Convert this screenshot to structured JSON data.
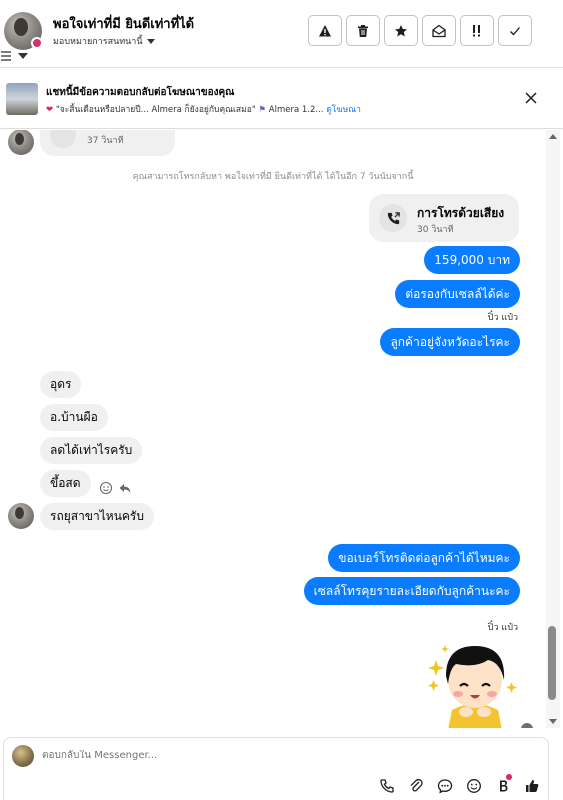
{
  "header": {
    "contact_name": "พอใจเท่าที่มี ยินดีเท่าที่ได้",
    "assign_label": "มอบหมายการสนทนานี้",
    "actions": [
      {
        "name": "report-button",
        "icon": "warning-icon"
      },
      {
        "name": "delete-button",
        "icon": "trash-icon"
      },
      {
        "name": "star-button",
        "icon": "star-icon"
      },
      {
        "name": "mark-unread-button",
        "icon": "envelope-open-icon"
      },
      {
        "name": "flag-button",
        "icon": "exclamation-icon"
      },
      {
        "name": "done-button",
        "icon": "check-icon"
      }
    ]
  },
  "ad_banner": {
    "title": "แชทนี้มีข้อความตอบกลับต่อโฆษณาของคุณ",
    "preview_text": "\"จะสิ้นเดือนหรือปลายปี... Almera ก็ยังอยู่กับคุณเสมอ\"",
    "preview_tail": "Almera 1.2...",
    "link_label": "ดูโฆษณา"
  },
  "thread": {
    "top_call_duration": "37 วินาที",
    "notice": "คุณสามารถโทรกลับหา พอใจเท่าที่มี ยินดีเท่าที่ได้ ได้ในอีก 7 วันนับจากนี้",
    "call_card": {
      "title": "การโทรด้วยเสียง",
      "duration": "30 วินาที"
    },
    "outgoing_1": [
      "159,000 บาท",
      "ต่อรองกับเซลล์ได้ค่ะ"
    ],
    "sender_1": "ปิ๋ว แป๋ว",
    "outgoing_2": [
      "ลูกค้าอยู่จังหวัดอะไรคะ"
    ],
    "incoming": [
      "อุดร",
      "อ.บ้านผือ",
      "ลดได้เท่าไรครับ",
      "ขึ้อสด",
      "รถยุสาขาไหนครับ"
    ],
    "outgoing_3": [
      "ขอเบอร์โทรติดต่อลูกค้าได้ไหมคะ",
      "เซลล์โทรคุยรายละเอียดกับลูกค้านะคะ"
    ],
    "sender_2": "ปิ๋ว แป๋ว"
  },
  "composer": {
    "placeholder": "ตอบกลับใน Messenger...",
    "icons": [
      "phone-icon",
      "attachment-icon",
      "chat-bubble-icon",
      "emoji-icon",
      "bold-icon",
      "like-icon"
    ]
  },
  "colors": {
    "accent": "#0a7cff",
    "incoming_bubble": "#f0f0f0"
  }
}
